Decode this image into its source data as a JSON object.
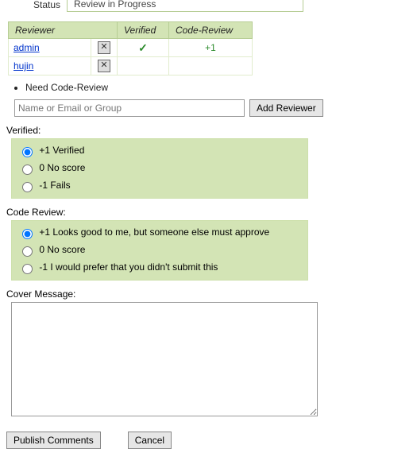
{
  "status_row": {
    "label": "Status",
    "value": "Review in Progress"
  },
  "reviewers_table": {
    "headers": {
      "reviewer": "Reviewer",
      "verified": "Verified",
      "code_review": "Code-Review"
    },
    "rows": [
      {
        "name": "admin",
        "verified": "✓",
        "code_review": "+1"
      },
      {
        "name": "hujin",
        "verified": "",
        "code_review": ""
      }
    ]
  },
  "needs": [
    "Need Code-Review"
  ],
  "add_reviewer": {
    "placeholder": "Name or Email or Group",
    "button": "Add Reviewer"
  },
  "verified_section": {
    "label": "Verified:",
    "options": [
      {
        "text": "+1 Verified",
        "selected": true
      },
      {
        "text": "0 No score",
        "selected": false
      },
      {
        "text": "-1 Fails",
        "selected": false
      }
    ]
  },
  "code_review_section": {
    "label": "Code Review:",
    "options": [
      {
        "text": "+1 Looks good to me, but someone else must approve",
        "selected": true
      },
      {
        "text": "0 No score",
        "selected": false
      },
      {
        "text": "-1 I would prefer that you didn't submit this",
        "selected": false
      }
    ]
  },
  "cover": {
    "label": "Cover Message:",
    "value": ""
  },
  "buttons": {
    "publish": "Publish Comments",
    "cancel": "Cancel"
  }
}
